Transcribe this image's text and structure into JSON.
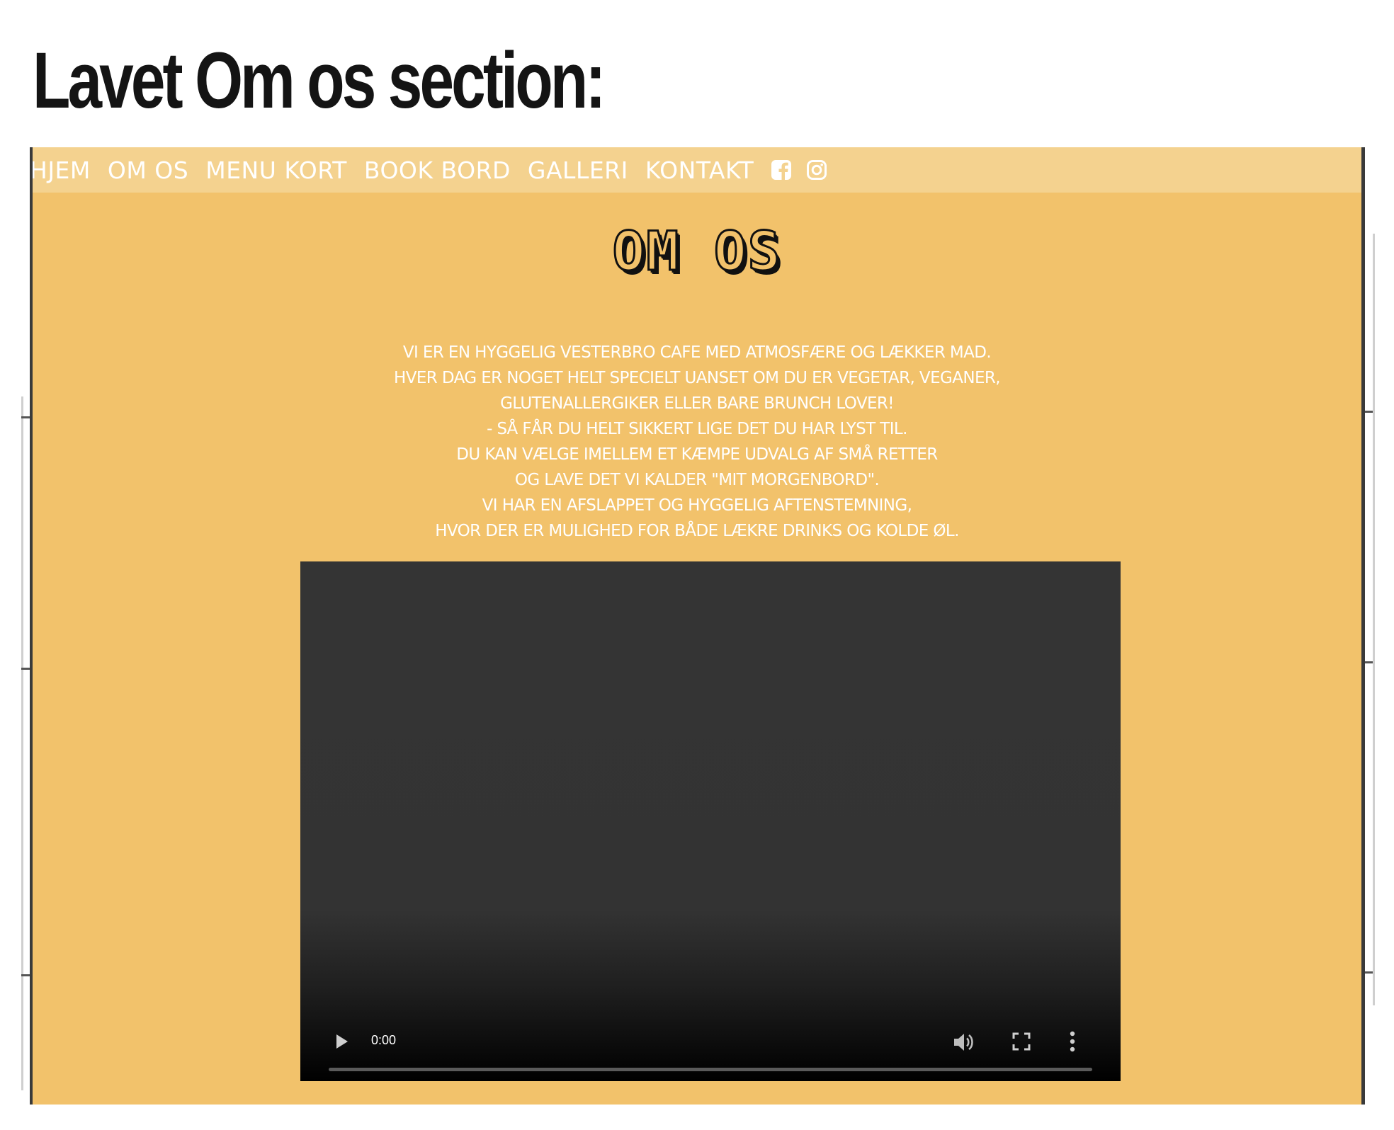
{
  "heading": "Lavet Om os section:",
  "nav": {
    "items": [
      "HJEM",
      "OM OS",
      "MENU KORT",
      "BOOK BORD",
      "GALLERI",
      "KONTAKT"
    ],
    "icons": [
      "facebook-icon",
      "instagram-icon"
    ]
  },
  "section": {
    "title": "OM OS",
    "lines": [
      "VI ER EN HYGGELIG VESTERBRO CAFE MED ATMOSFÆRE OG LÆKKER MAD.",
      "HVER DAG ER NOGET HELT SPECIELT UANSET OM DU ER VEGETAR, VEGANER,",
      "GLUTENALLERGIKER ELLER BARE BRUNCH LOVER!",
      "- SÅ FÅR DU HELT SIKKERT LIGE DET DU HAR LYST TIL.",
      "DU KAN VÆLGE IMELLEM ET KÆMPE UDVALG AF SMÅ RETTER",
      "OG LAVE DET VI KALDER \"MIT MORGENBORD\".",
      "VI HAR EN AFSLAPPET OG HYGGELIG AFTENSTEMNING,",
      "HVOR DER ER MULIGHED FOR BÅDE LÆKRE DRINKS OG KOLDE ØL."
    ]
  },
  "video": {
    "time": "0:00",
    "progress": 0
  },
  "colors": {
    "section_bg": "#f2c26b",
    "nav_bg": "#f4d28f",
    "text": "#ffffff",
    "video_bg": "#333333"
  }
}
